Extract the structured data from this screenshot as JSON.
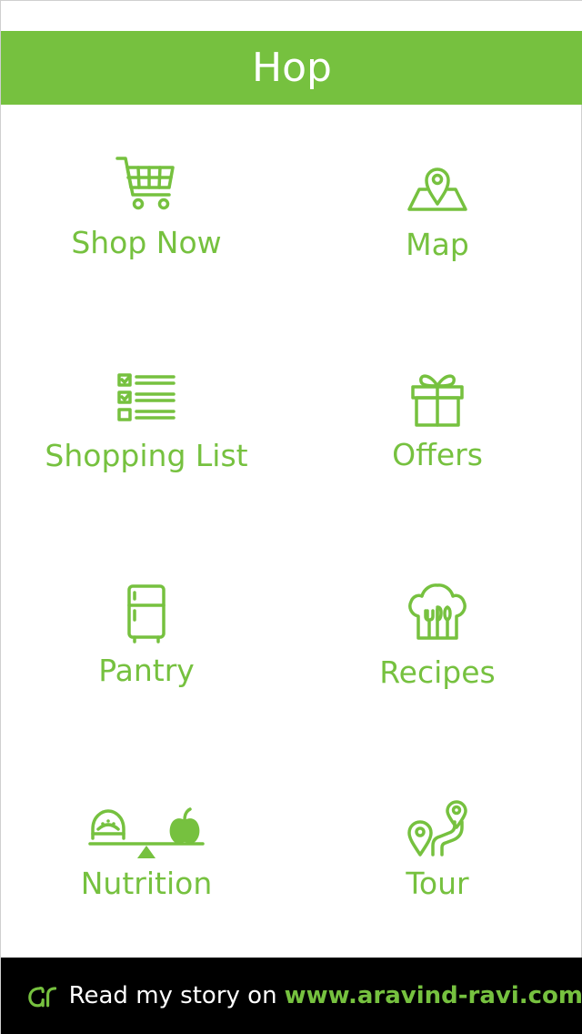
{
  "app": {
    "title": "Hop",
    "accent_color": "#76c13f"
  },
  "menu": {
    "items": [
      {
        "label": "Shop Now",
        "icon": "shopping-cart-icon"
      },
      {
        "label": "Map",
        "icon": "map-pin-icon"
      },
      {
        "label": "Shopping List",
        "icon": "checklist-icon"
      },
      {
        "label": "Offers",
        "icon": "gift-icon"
      },
      {
        "label": "Pantry",
        "icon": "refrigerator-icon"
      },
      {
        "label": "Recipes",
        "icon": "chef-hat-cutlery-icon"
      },
      {
        "label": "Nutrition",
        "icon": "balance-scale-burger-apple-icon"
      },
      {
        "label": "Tour",
        "icon": "route-pins-icon"
      }
    ]
  },
  "footer": {
    "logo_text": "ar",
    "story_text": "Read my story on",
    "link_text": "www.aravind-ravi.com",
    "background": "#000000"
  }
}
